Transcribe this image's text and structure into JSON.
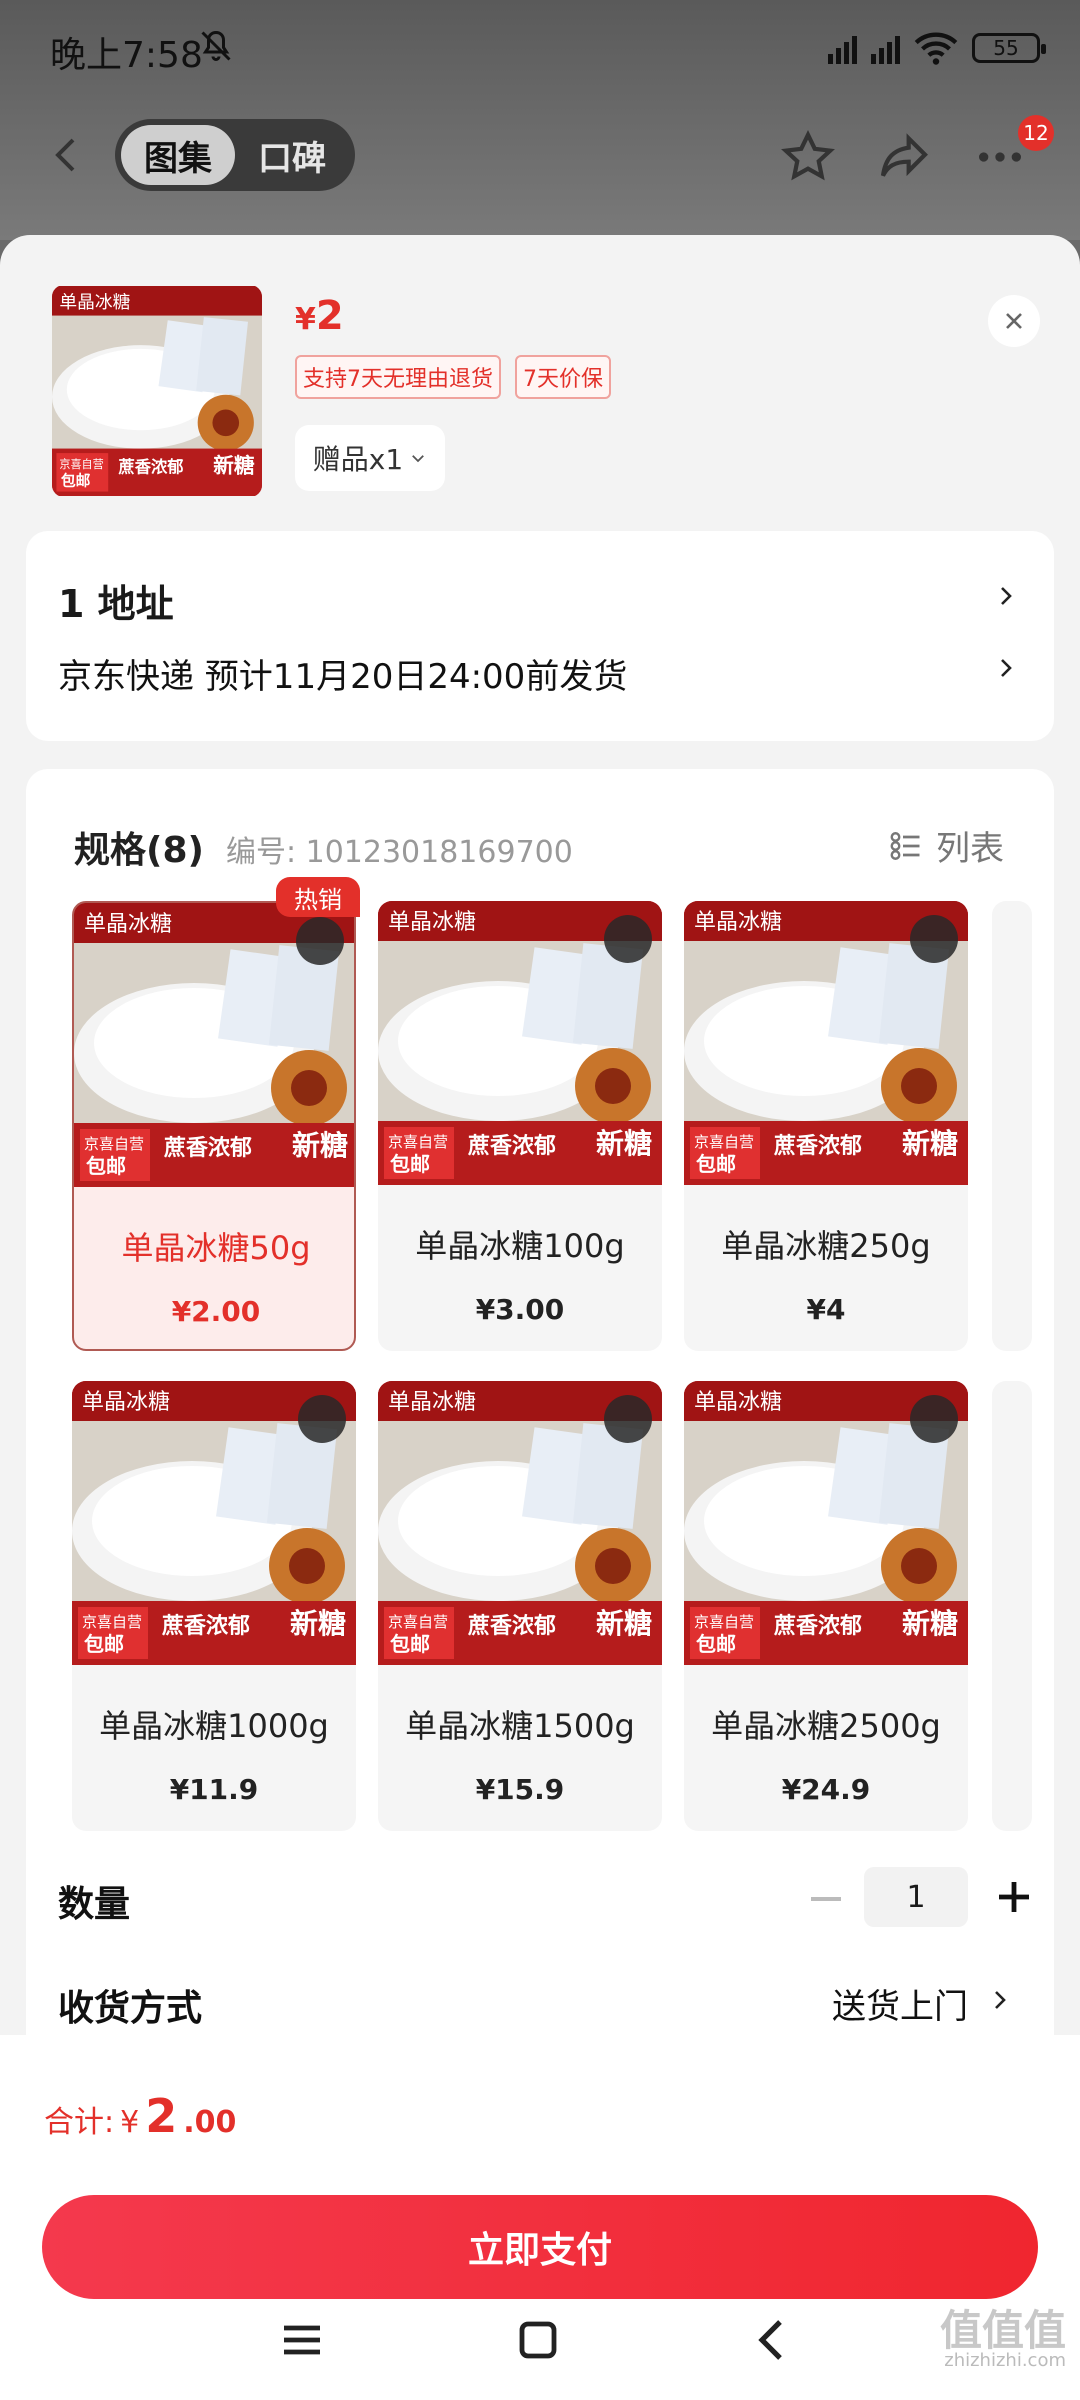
{
  "status_bar": {
    "time": "晚上7:58",
    "battery": "55"
  },
  "top_nav": {
    "tabs": [
      "图集",
      "口碑"
    ],
    "active_tab": 0,
    "message_count": "12"
  },
  "product": {
    "price_symbol": "¥",
    "price": "2",
    "tags": [
      "支持7天无理由退货",
      "7天价保"
    ],
    "gift_label": "赠品x1",
    "thumb_text": {
      "brand": "单晶冰糖",
      "slogan": "蔗香浓郁",
      "new": "新糖",
      "tag1": "京喜自营",
      "tag2": "包邮"
    }
  },
  "address": {
    "title": "1  地址",
    "shipping": "京东快递 预计11月20日24:00前发货"
  },
  "spec": {
    "title": "规格(8)",
    "number_label": "编号: 10123018169700",
    "list_label": "列表",
    "hot_badge": "热销",
    "items": [
      {
        "name": "单晶冰糖50g",
        "price": "¥2.00",
        "selected": true
      },
      {
        "name": "单晶冰糖100g",
        "price": "¥3.00",
        "selected": false
      },
      {
        "name": "单晶冰糖250g",
        "price": "¥4",
        "selected": false
      },
      {
        "name": "单晶冰糖1000g",
        "price": "¥11.9",
        "selected": false
      },
      {
        "name": "单晶冰糖1500g",
        "price": "¥15.9",
        "selected": false
      },
      {
        "name": "单晶冰糖2500g",
        "price": "¥24.9",
        "selected": false
      }
    ]
  },
  "quantity": {
    "label": "数量",
    "value": "1"
  },
  "delivery": {
    "label": "收货方式",
    "value": "送货上门"
  },
  "footer": {
    "total_label": "合计:",
    "total_symbol": "¥",
    "total_int": "2",
    "total_dec": ".00",
    "pay_label": "立即支付"
  },
  "watermark": {
    "text": "值值值",
    "url": "zhizhizhi.com"
  }
}
